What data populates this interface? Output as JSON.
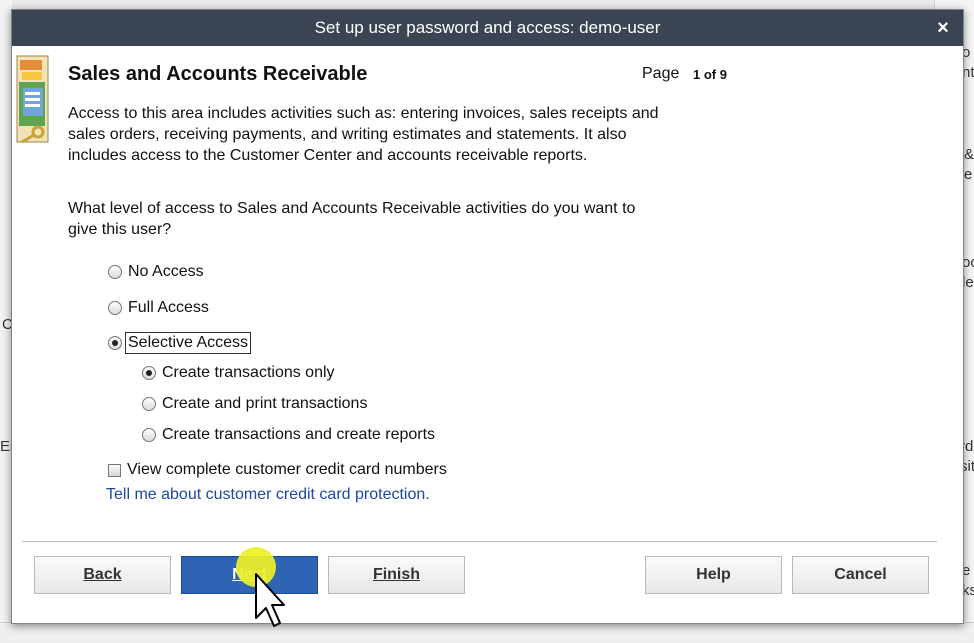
{
  "window": {
    "title": "Set up user password and access: demo-user",
    "close_label": "×"
  },
  "section": {
    "heading": "Sales and Accounts Receivable",
    "page_label": "Page",
    "page_value": "1 of 9",
    "description": "Access to this area includes activities such as: entering invoices, sales receipts and sales orders, receiving payments, and writing estimates and statements. It also includes access to the Customer Center and accounts receivable reports.",
    "question": "What level of access to Sales and Accounts Receivable activities do you want to give this user?"
  },
  "access_options": [
    {
      "label": "No Access",
      "checked": false
    },
    {
      "label": "Full Access",
      "checked": false
    },
    {
      "label": "Selective Access",
      "checked": true
    }
  ],
  "selective_options": [
    {
      "label": "Create transactions only",
      "checked": true
    },
    {
      "label": "Create and print transactions",
      "checked": false
    },
    {
      "label": "Create transactions and create reports",
      "checked": false
    }
  ],
  "credit_card": {
    "label": "View complete customer credit card numbers",
    "checked": false
  },
  "help_link": "Tell me about customer credit card protection.",
  "buttons": {
    "back": "Back",
    "next": "Next",
    "finish": "Finish",
    "help": "Help",
    "cancel": "Cancel"
  },
  "background_fragments": [
    "o",
    "nt",
    "&",
    "e",
    "oc",
    "le",
    "C",
    "Es",
    "rd",
    "sit",
    "e",
    "ks"
  ]
}
